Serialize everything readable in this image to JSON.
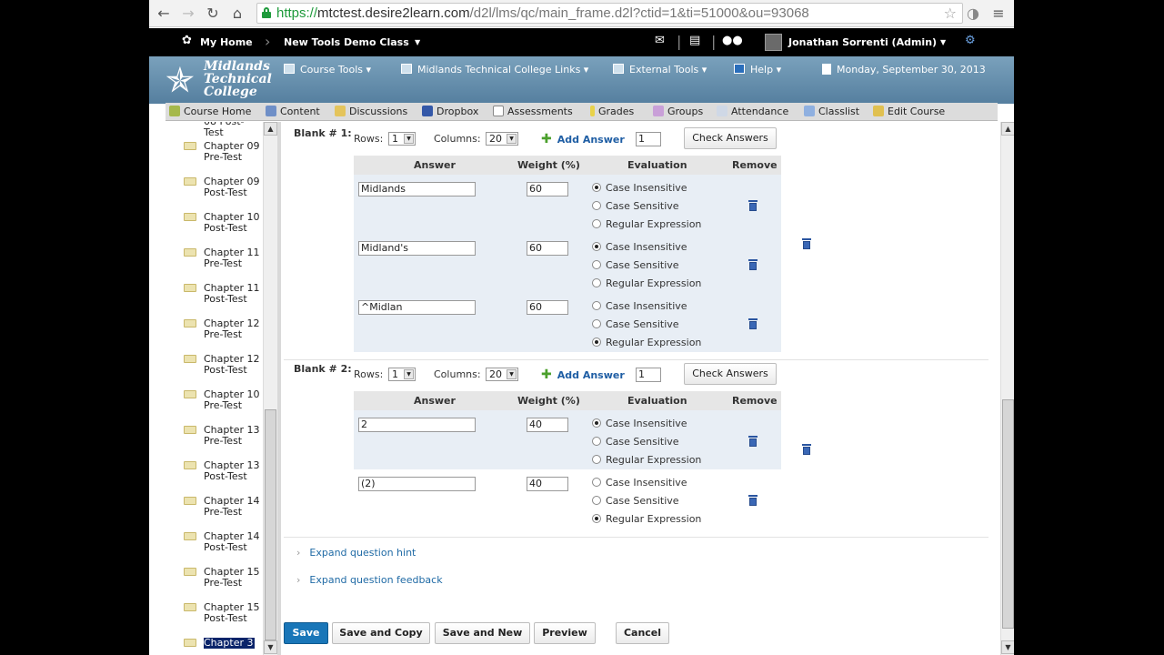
{
  "browser": {
    "url_scheme": "https://",
    "url_host": "mtctest.desire2learn.com",
    "url_path": "/d2l/lms/qc/main_frame.d2l?ctid=1&ti=51000&ou=93068"
  },
  "topbar": {
    "home": "My Home",
    "course": "New Tools Demo Class",
    "user": "Jonathan Sorrenti (Admin)"
  },
  "banner": {
    "logo_line1": "Midlands",
    "logo_line2": "Technical",
    "logo_line3": "College",
    "nav": [
      "Course Tools",
      "Midlands Technical College Links",
      "External Tools",
      "Help"
    ],
    "date": "Monday, September 30, 2013"
  },
  "course_nav": [
    "Course Home",
    "Content",
    "Discussions",
    "Dropbox",
    "Assessments",
    "Grades",
    "Groups",
    "Attendance",
    "Classlist",
    "Edit Course"
  ],
  "tree": [
    "08 Post-Test",
    "Chapter 09 Pre-Test",
    "Chapter 09 Post-Test",
    "Chapter 10 Post-Test",
    "Chapter 11 Pre-Test",
    "Chapter 11 Post-Test",
    "Chapter 12 Pre-Test",
    "Chapter 12 Post-Test",
    "Chapter 10 Pre-Test",
    "Chapter 13 Pre-Test",
    "Chapter 13 Post-Test",
    "Chapter 14 Pre-Test",
    "Chapter 14 Post-Test",
    "Chapter 15 Pre-Test",
    "Chapter 15 Post-Test",
    "Chapter 3"
  ],
  "labels": {
    "rows": "Rows:",
    "columns": "Columns:",
    "add_answer": "Add Answer",
    "check_answers": "Check Answers",
    "col_answer": "Answer",
    "col_weight": "Weight (%)",
    "col_evaluation": "Evaluation",
    "col_remove": "Remove",
    "case_insensitive": "Case Insensitive",
    "case_sensitive": "Case Sensitive",
    "regex": "Regular Expression",
    "expand_hint": "Expand question hint",
    "expand_feedback": "Expand question feedback"
  },
  "blanks": [
    {
      "label": "Blank # 1:",
      "rows": "1",
      "columns": "20",
      "add_count": "1",
      "answers": [
        {
          "answer": "Midlands",
          "weight": "60",
          "evaluation": "Case Insensitive"
        },
        {
          "answer": "Midland's",
          "weight": "60",
          "evaluation": "Case Insensitive"
        },
        {
          "answer": "^Midlan",
          "weight": "60",
          "evaluation": "Regular Expression"
        }
      ]
    },
    {
      "label": "Blank # 2:",
      "rows": "1",
      "columns": "20",
      "add_count": "1",
      "answers": [
        {
          "answer": "2",
          "weight": "40",
          "evaluation": "Case Insensitive"
        },
        {
          "answer": "(2)",
          "weight": "40",
          "evaluation": "Regular Expression"
        }
      ]
    }
  ],
  "buttons": {
    "save": "Save",
    "save_copy": "Save and Copy",
    "save_new": "Save and New",
    "preview": "Preview",
    "cancel": "Cancel"
  }
}
